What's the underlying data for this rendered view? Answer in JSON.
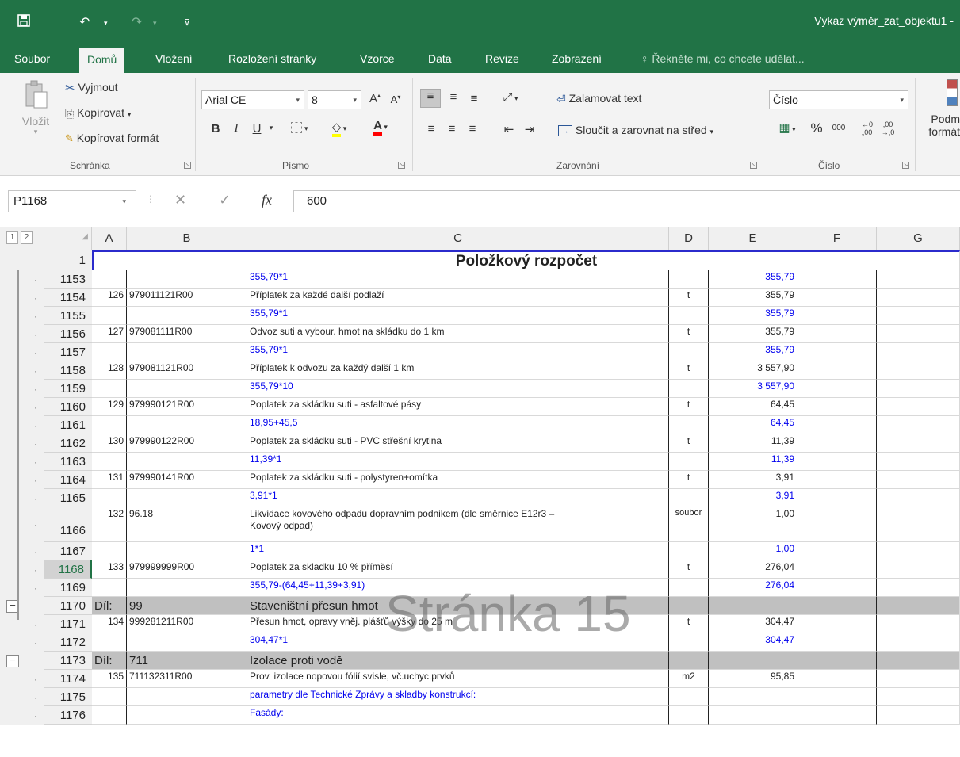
{
  "titlebar": {
    "doc_title": "Výkaz výměr_zat_objektu1 -"
  },
  "tabs": [
    {
      "label": "Soubor"
    },
    {
      "label": "Domů"
    },
    {
      "label": "Vložení"
    },
    {
      "label": "Rozložení stránky"
    },
    {
      "label": "Vzorce"
    },
    {
      "label": "Data"
    },
    {
      "label": "Revize"
    },
    {
      "label": "Zobrazení"
    }
  ],
  "tell_me": "Řekněte mi, co chcete udělat...",
  "ribbon": {
    "clipboard": {
      "paste": "Vložit",
      "cut": "Vyjmout",
      "copy": "Kopírovat",
      "format_painter": "Kopírovat formát",
      "label": "Schránka"
    },
    "font": {
      "name": "Arial CE",
      "size": "8",
      "label": "Písmo",
      "bold": "B",
      "italic": "I",
      "underline": "U",
      "font_color": "A"
    },
    "alignment": {
      "wrap": "Zalamovat text",
      "merge": "Sloučit a zarovnat na střed",
      "label": "Zarovnání"
    },
    "number": {
      "format": "Číslo",
      "percent": "%",
      "thousands": "000",
      "label": "Číslo"
    },
    "styles": {
      "conditional": "Podm",
      "conditional2": "formát"
    }
  },
  "formula_bar": {
    "name_box": "P1168",
    "fx": "fx",
    "value": "600"
  },
  "outline_levels": [
    "1",
    "2"
  ],
  "columns": [
    "A",
    "B",
    "C",
    "D",
    "E",
    "F",
    "G"
  ],
  "sheet": {
    "title": "Položkový rozpočet",
    "watermark": "Stránka 15",
    "rows": [
      {
        "n": "1153",
        "a": "",
        "b": "",
        "c": "355,79*1",
        "d": "",
        "e": "355,79",
        "blue": true
      },
      {
        "n": "1154",
        "a": "126",
        "b": "979011121R00",
        "c": "Příplatek za každé další podlaží",
        "d": "t",
        "e": "355,79",
        "blue": false
      },
      {
        "n": "1155",
        "a": "",
        "b": "",
        "c": "355,79*1",
        "d": "",
        "e": "355,79",
        "blue": true
      },
      {
        "n": "1156",
        "a": "127",
        "b": "979081111R00",
        "c": "Odvoz suti a vybour. hmot na skládku do 1 km",
        "d": "t",
        "e": "355,79",
        "blue": false
      },
      {
        "n": "1157",
        "a": "",
        "b": "",
        "c": "355,79*1",
        "d": "",
        "e": "355,79",
        "blue": true
      },
      {
        "n": "1158",
        "a": "128",
        "b": "979081121R00",
        "c": "Příplatek k odvozu za každý další 1 km",
        "d": "t",
        "e": "3 557,90",
        "blue": false
      },
      {
        "n": "1159",
        "a": "",
        "b": "",
        "c": "355,79*10",
        "d": "",
        "e": "3 557,90",
        "blue": true
      },
      {
        "n": "1160",
        "a": "129",
        "b": "979990121R00",
        "c": "Poplatek za skládku suti - asfaltové pásy",
        "d": "t",
        "e": "64,45",
        "blue": false
      },
      {
        "n": "1161",
        "a": "",
        "b": "",
        "c": "18,95+45,5",
        "d": "",
        "e": "64,45",
        "blue": true
      },
      {
        "n": "1162",
        "a": "130",
        "b": "979990122R00",
        "c": "Poplatek za skládku suti - PVC střešní krytina",
        "d": "t",
        "e": "11,39",
        "blue": false
      },
      {
        "n": "1163",
        "a": "",
        "b": "",
        "c": "11,39*1",
        "d": "",
        "e": "11,39",
        "blue": true
      },
      {
        "n": "1164",
        "a": "131",
        "b": "979990141R00",
        "c": "Poplatek za skládku suti - polystyren+omítka",
        "d": "t",
        "e": "3,91",
        "blue": false
      },
      {
        "n": "1165",
        "a": "",
        "b": "",
        "c": "3,91*1",
        "d": "",
        "e": "3,91",
        "blue": true
      },
      {
        "n": "1166",
        "a": "132",
        "b": "96.18",
        "c": "Likvidace kovového odpadu dopravním podnikem (dle směrnice E12r3 –",
        "c2": "Kovový odpad)",
        "d": "soubor",
        "e": "1,00",
        "blue": false
      },
      {
        "n": "1167",
        "a": "",
        "b": "",
        "c": "1*1",
        "d": "",
        "e": "1,00",
        "blue": true
      },
      {
        "n": "1168",
        "a": "133",
        "b": "979999999R00",
        "c": "Poplatek za skladku 10 % příměsí",
        "d": "t",
        "e": "276,04",
        "blue": false
      },
      {
        "n": "1169",
        "a": "",
        "b": "",
        "c": "355,79-(64,45+11,39+3,91)",
        "d": "",
        "e": "276,04",
        "blue": true
      },
      {
        "n": "1170",
        "a": "Díl:",
        "b": "99",
        "c": "Staveništní přesun hmot",
        "d": "",
        "e": "",
        "blue": false
      },
      {
        "n": "1171",
        "a": "134",
        "b": "999281211R00",
        "c": "Přesun hmot, opravy vněj. plášťů výšky do 25 m",
        "d": "t",
        "e": "304,47",
        "blue": false
      },
      {
        "n": "1172",
        "a": "",
        "b": "",
        "c": "304,47*1",
        "d": "",
        "e": "304,47",
        "blue": true
      },
      {
        "n": "1173",
        "a": "Díl:",
        "b": "711",
        "c": "Izolace proti vodě",
        "d": "",
        "e": "",
        "blue": false
      },
      {
        "n": "1174",
        "a": "135",
        "b": "711132311R00",
        "c": "Prov. izolace nopovou fólií svisle, vč.uchyc.prvků",
        "d": "m2",
        "e": "95,85",
        "blue": false
      },
      {
        "n": "1175",
        "a": "",
        "b": "",
        "c": "parametry dle Technické Zprávy a skladby konstrukcí:",
        "d": "",
        "e": "",
        "blue": true
      },
      {
        "n": "1176",
        "a": "",
        "b": "",
        "c": "Fasády:",
        "d": "",
        "e": "",
        "blue": true
      }
    ]
  },
  "colors": {
    "excel_green": "#217346",
    "formula_blue": "#0000ee",
    "section_grey": "#c0c0c0"
  }
}
